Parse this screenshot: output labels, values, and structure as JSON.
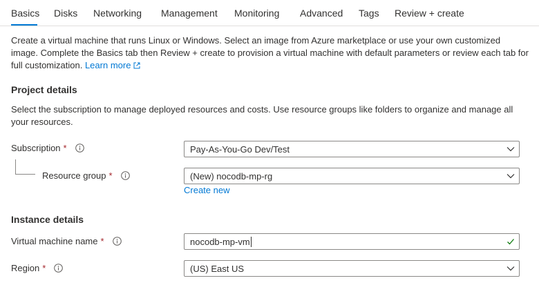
{
  "tabs": [
    "Basics",
    "Disks",
    "Networking",
    "Management",
    "Monitoring",
    "Advanced",
    "Tags",
    "Review + create"
  ],
  "intro": {
    "text": "Create a virtual machine that runs Linux or Windows. Select an image from Azure marketplace or use your own customized image. Complete the Basics tab then Review + create to provision a virtual machine with default parameters or review each tab for full customization.",
    "link": "Learn more"
  },
  "project": {
    "title": "Project details",
    "desc": "Select the subscription to manage deployed resources and costs. Use resource groups like folders to organize and manage all your resources.",
    "subscription_label": "Subscription",
    "subscription_value": "Pay-As-You-Go Dev/Test",
    "rg_label": "Resource group",
    "rg_value": "(New) nocodb-mp-rg",
    "create_new": "Create new"
  },
  "instance": {
    "title": "Instance details",
    "vm_name_label": "Virtual machine name",
    "vm_name_value": "nocodb-mp-vm",
    "region_label": "Region",
    "region_value": "(US) East US"
  },
  "required_mark": "*",
  "colors": {
    "accent": "#0078d4",
    "required": "#a4262c",
    "valid": "#107c10"
  }
}
